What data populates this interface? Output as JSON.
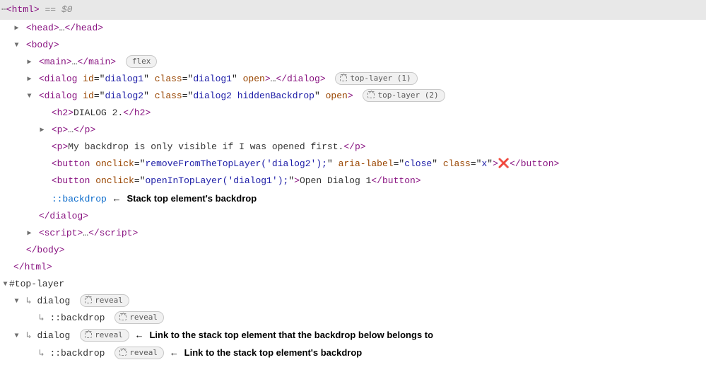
{
  "highlight": {
    "ellipsis": "⋯",
    "open_tag": "html",
    "eq_token": " == ",
    "var": "$0"
  },
  "tree": {
    "head": {
      "tag": "head",
      "dots": "…"
    },
    "body_open": {
      "tag": "body"
    },
    "main": {
      "tag": "main",
      "dots": "…",
      "badge": "flex"
    },
    "dialog1": {
      "tag": "dialog",
      "attrs": [
        {
          "n": "id",
          "v": "dialog1"
        },
        {
          "n": "class",
          "v": "dialog1"
        },
        {
          "n": "open",
          "v": null
        }
      ],
      "dots": "…",
      "badge": "top-layer (1)"
    },
    "dialog2": {
      "tag": "dialog",
      "attrs": [
        {
          "n": "id",
          "v": "dialog2"
        },
        {
          "n": "class",
          "v": "dialog2 hiddenBackdrop"
        },
        {
          "n": "open",
          "v": null
        }
      ],
      "badge": "top-layer (2)"
    },
    "h2": {
      "tag": "h2",
      "text": "DIALOG 2."
    },
    "p1": {
      "tag": "p",
      "dots": "…"
    },
    "p2": {
      "tag": "p",
      "text": "My backdrop is only visible if I was opened first."
    },
    "btn_close": {
      "tag": "button",
      "attrs": [
        {
          "n": "onclick",
          "v": "removeFromTheTopLayer('dialog2');"
        },
        {
          "n": "aria-label",
          "v": "close"
        },
        {
          "n": "class",
          "v": "x"
        }
      ],
      "glyph": "❌"
    },
    "btn_open1": {
      "tag": "button",
      "attrs": [
        {
          "n": "onclick",
          "v": "openInTopLayer('dialog1');"
        }
      ],
      "text": "Open Dialog 1"
    },
    "backdrop_pseudo": "::backdrop",
    "backdrop_annot": "Stack top element's backdrop",
    "dialog2_close": "dialog",
    "script": {
      "tag": "script",
      "dots": "…"
    },
    "body_close": "body",
    "html_close": "html"
  },
  "toplayer": {
    "header": "#top-layer",
    "items": [
      {
        "label": "dialog",
        "reveal": "reveal",
        "annot": ""
      },
      {
        "label": "::backdrop",
        "reveal": "reveal",
        "annot": "",
        "child": true
      },
      {
        "label": "dialog",
        "reveal": "reveal",
        "annot": "Link to the stack top element that the backdrop below belongs to"
      },
      {
        "label": "::backdrop",
        "reveal": "reveal",
        "annot": "Link to the stack top element's backdrop",
        "child": true
      }
    ]
  },
  "arrows": {
    "left": "←"
  }
}
